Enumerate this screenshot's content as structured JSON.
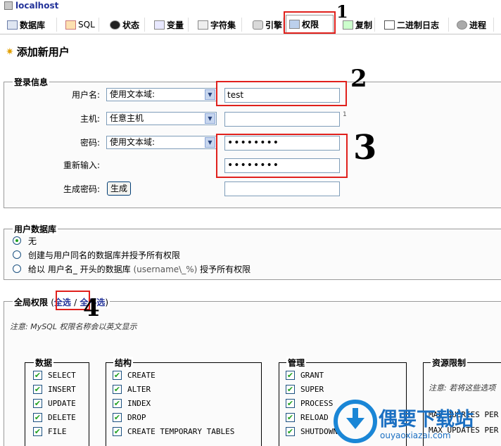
{
  "header": {
    "server": "localhost"
  },
  "tabs": [
    {
      "label": "数据库",
      "icon": "database-icon"
    },
    {
      "label": "SQL",
      "icon": "sql-icon"
    },
    {
      "label": "状态",
      "icon": "status-icon"
    },
    {
      "label": "变量",
      "icon": "variables-icon"
    },
    {
      "label": "字符集",
      "icon": "charset-icon"
    },
    {
      "label": "引擎",
      "icon": "engine-icon"
    },
    {
      "label": "权限",
      "icon": "privileges-icon"
    },
    {
      "label": "复制",
      "icon": "replication-icon"
    },
    {
      "label": "二进制日志",
      "icon": "binlog-icon"
    },
    {
      "label": "进程",
      "icon": "process-icon"
    }
  ],
  "page": {
    "title": "添加新用户"
  },
  "annotations": [
    "1",
    "2",
    "3",
    "4"
  ],
  "login": {
    "legend": "登录信息",
    "username_label": "用户名:",
    "username_select": "使用文本域:",
    "username_value": "test",
    "host_label": "主机:",
    "host_select": "任意主机",
    "host_sup": "1",
    "password_label": "密码:",
    "password_select": "使用文本域:",
    "password_value": "••••••••",
    "retype_label": "重新输入:",
    "retype_value": "••••••••",
    "generate_label": "生成密码:",
    "generate_button": "生成"
  },
  "userdb": {
    "legend": "用户数据库",
    "options": [
      {
        "text": "无",
        "selected": true
      },
      {
        "text": "创建与用户同名的数据库并授予所有权限",
        "selected": false
      },
      {
        "text_a": "给以 用户名_ 开头的数据库",
        "text_b": "(username\\_%)",
        "text_c": "授予所有权限",
        "selected": false
      }
    ]
  },
  "global": {
    "legend": "全局权限",
    "open_paren": "(",
    "select_all": "全选",
    "slash": "/",
    "select_none": "全不选",
    "close_paren": ")",
    "note": "注意: MySQL 权限名称会以英文显示",
    "groups": [
      {
        "title": "数据",
        "items": [
          "SELECT",
          "INSERT",
          "UPDATE",
          "DELETE",
          "FILE"
        ]
      },
      {
        "title": "结构",
        "items": [
          "CREATE",
          "ALTER",
          "INDEX",
          "DROP",
          "CREATE TEMPORARY TABLES"
        ]
      },
      {
        "title": "管理",
        "items": [
          "GRANT",
          "SUPER",
          "PROCESS",
          "RELOAD",
          "SHUTDOWN"
        ]
      }
    ],
    "resource": {
      "title": "资源限制",
      "note": "注意: 若将这些选项",
      "lines": [
        "MAX QUERIES PER HOUR",
        "MAX UPDATES PER HOUR"
      ]
    }
  },
  "watermark": {
    "name": "偶要下载站",
    "url": "ouyaoxiazai.com"
  }
}
